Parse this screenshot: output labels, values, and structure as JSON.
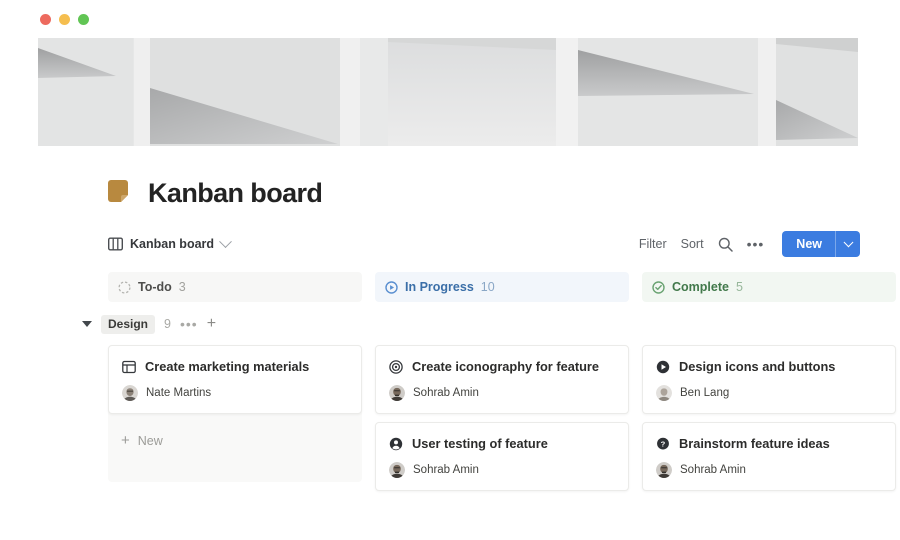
{
  "window": {
    "controls": [
      {
        "name": "close",
        "color": "#ED6A5E"
      },
      {
        "name": "minimize",
        "color": "#F5BE4F"
      },
      {
        "name": "maximize",
        "color": "#61C554"
      }
    ]
  },
  "cover": {
    "alt": "abstract grayscale architecture with angular shadows"
  },
  "header": {
    "icon": "folded-document-icon",
    "icon_color": "#B8893F",
    "title": "Kanban board"
  },
  "toolbar": {
    "view_icon": "board-columns-icon",
    "view_label": "Kanban board",
    "filter_label": "Filter",
    "sort_label": "Sort",
    "search_icon": "search-icon",
    "more_icon": "ellipsis-icon",
    "new_label": "New",
    "new_caret_icon": "chevron-down-icon",
    "new_color": "#3B7CE0"
  },
  "group": {
    "collapse_icon": "caret-down-icon",
    "label": "Design",
    "count": "9",
    "more_icon": "ellipsis-icon",
    "add_icon": "plus-icon"
  },
  "columns": [
    {
      "key": "todo",
      "status_icon": "dashed-circle-icon",
      "name": "To-do",
      "count": "3",
      "accent": "#4E4E4C",
      "cards": [
        {
          "icon": "browser-window-icon",
          "title": "Create marketing materials",
          "assignee": "Nate Martins"
        }
      ],
      "new_label": "New"
    },
    {
      "key": "progress",
      "status_icon": "play-circle-outline-icon",
      "name": "In Progress",
      "count": "10",
      "accent": "#3B6FA8",
      "cards": [
        {
          "icon": "target-icon",
          "title": "Create iconography for feature",
          "assignee": "Sohrab Amin"
        },
        {
          "icon": "person-filled-icon",
          "title": "User testing of feature",
          "assignee": "Sohrab Amin"
        }
      ]
    },
    {
      "key": "complete",
      "status_icon": "check-circle-icon",
      "name": "Complete",
      "count": "5",
      "accent": "#42794B",
      "cards": [
        {
          "icon": "play-circle-filled-icon",
          "title": "Design icons and buttons",
          "assignee": "Ben Lang"
        },
        {
          "icon": "question-circle-icon",
          "title": "Brainstorm feature ideas",
          "assignee": "Sohrab Amin"
        }
      ]
    }
  ]
}
